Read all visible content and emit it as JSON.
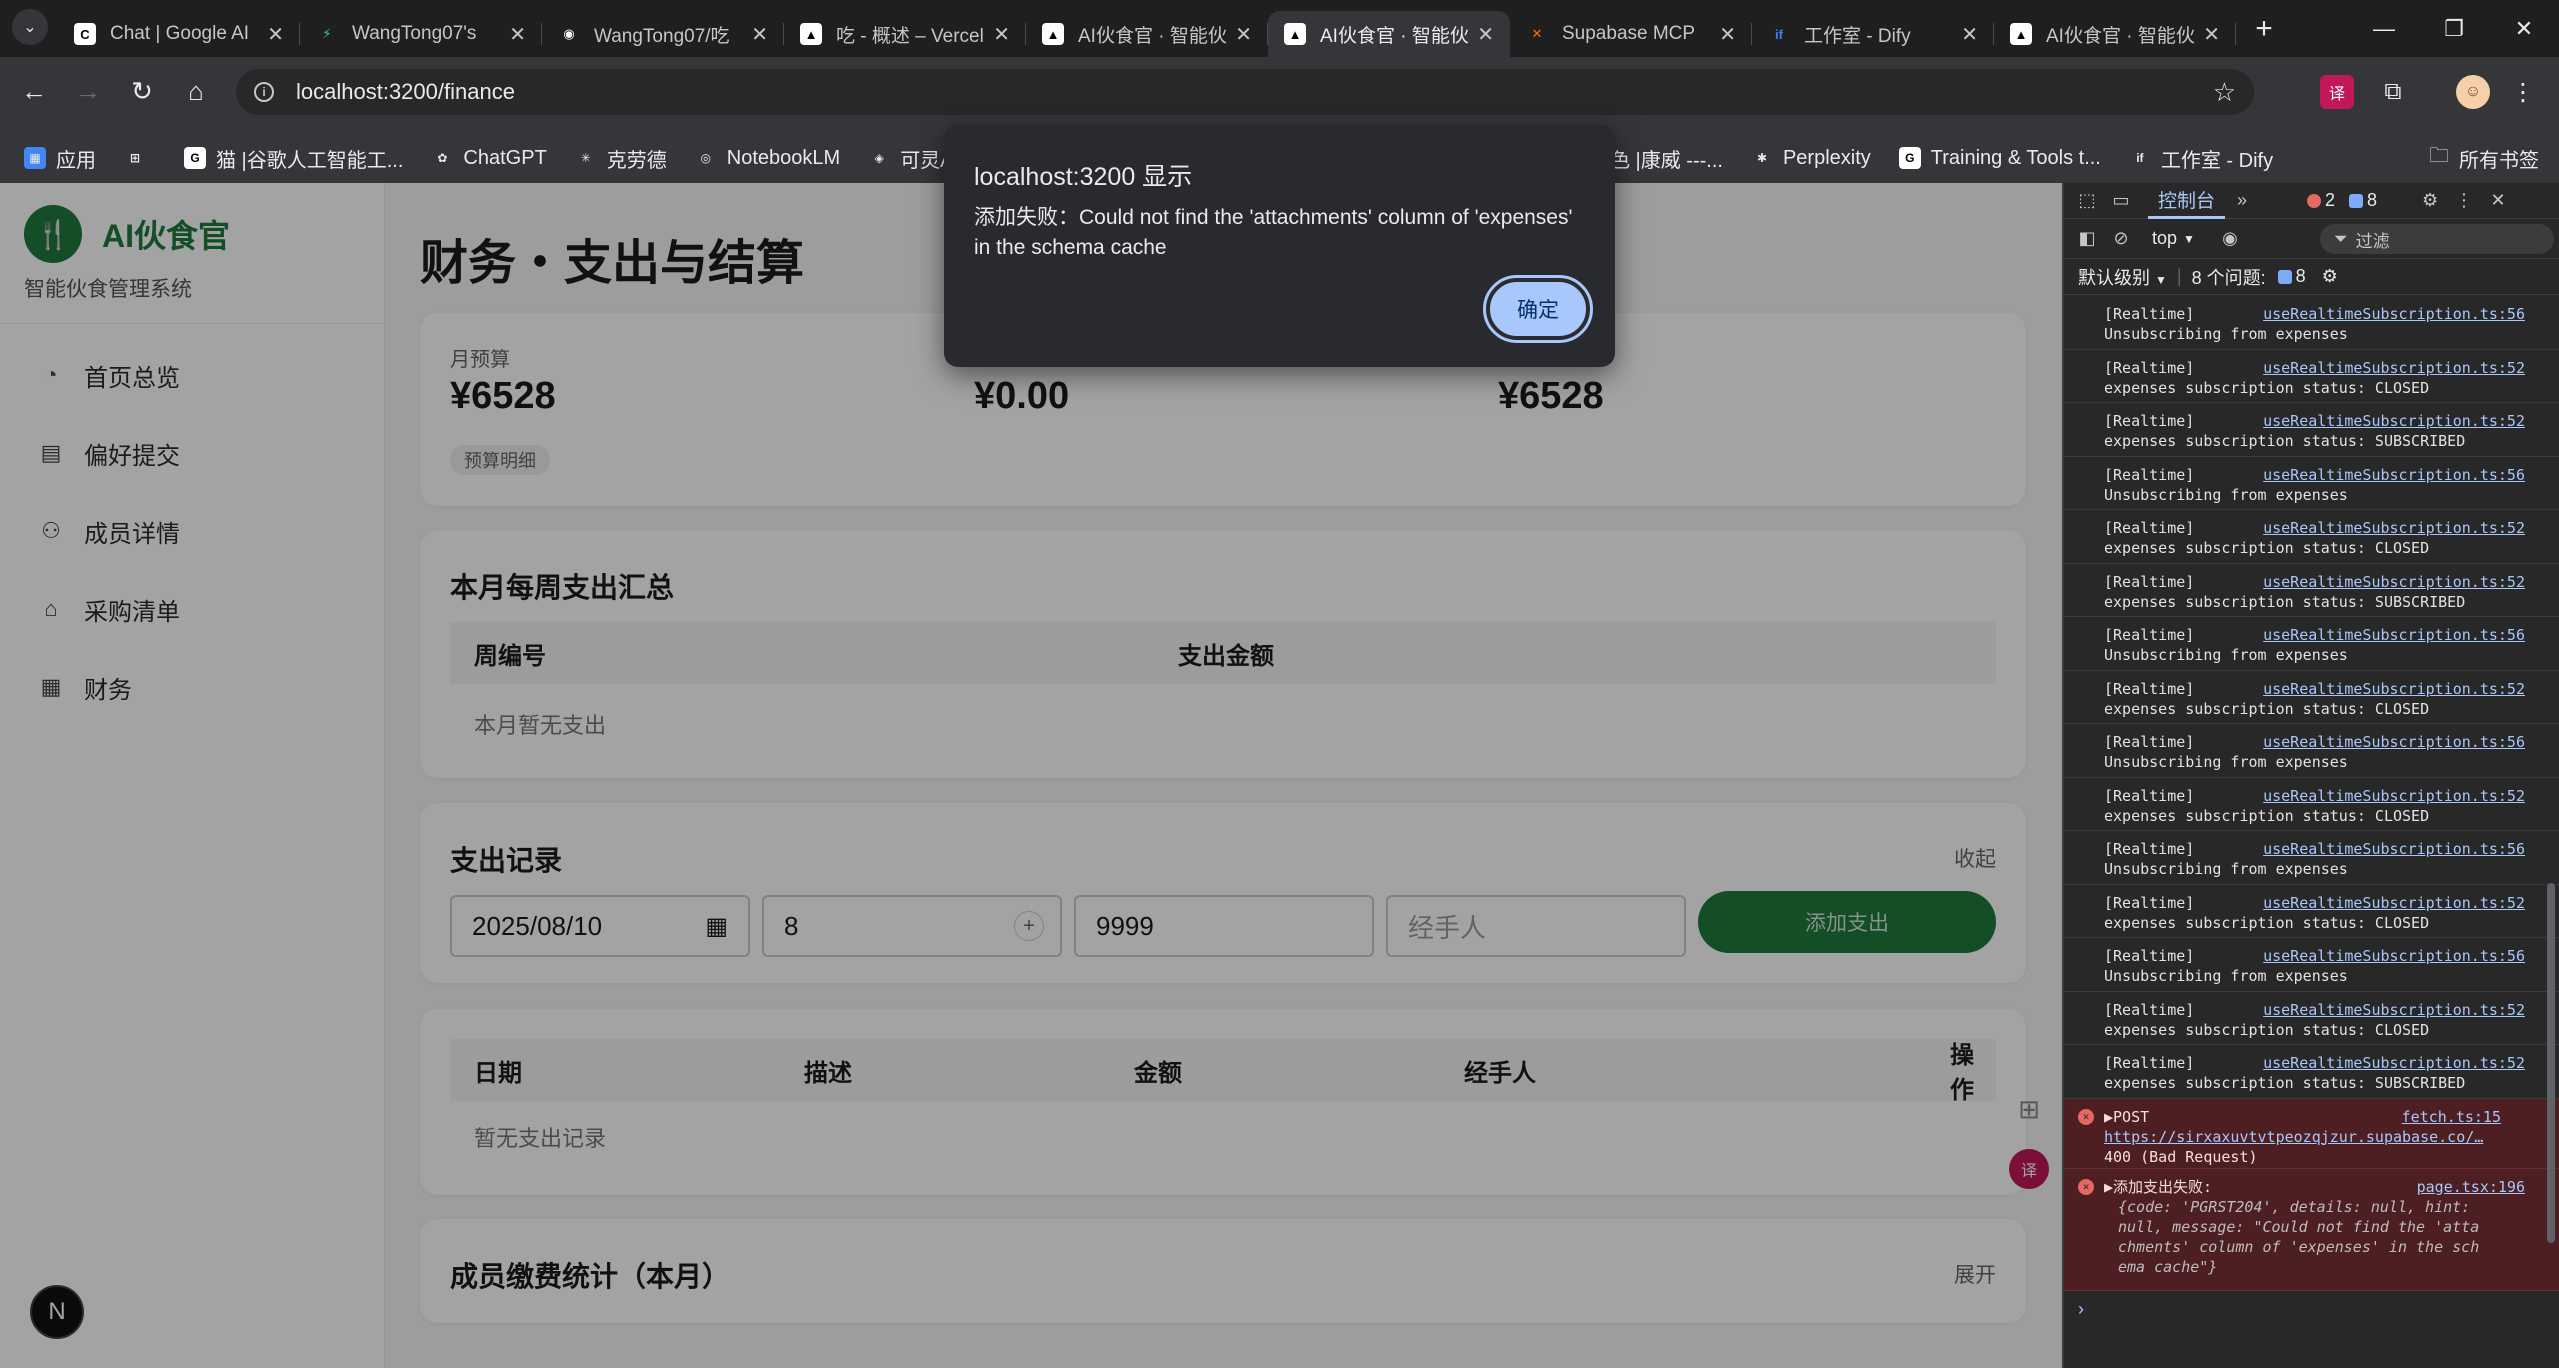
{
  "browser": {
    "tabs": [
      {
        "title": "Chat | Google AI",
        "icon_color": "#ffffff",
        "icon_fg": "#000000",
        "icon": "gemini-icon",
        "glyph": "C"
      },
      {
        "title": "WangTong07's",
        "icon_color": "#1f1f1f",
        "icon_fg": "#34d399",
        "icon": "bolt-icon",
        "glyph": "⚡"
      },
      {
        "title": "WangTong07/吃",
        "icon_color": "#1f1f1f",
        "icon_fg": "#ffffff",
        "icon": "github-icon",
        "glyph": "◉"
      },
      {
        "title": "吃 - 概述 – Vercel",
        "icon_color": "#ffffff",
        "icon_fg": "#000000",
        "icon": "vercel-icon",
        "glyph": "▲"
      },
      {
        "title": "AI伙食官 · 智能伙",
        "icon_color": "#ffffff",
        "icon_fg": "#000000",
        "icon": "vercel-icon",
        "glyph": "▲"
      },
      {
        "title": "AI伙食官 · 智能伙",
        "icon_color": "#ffffff",
        "icon_fg": "#000000",
        "icon": "vercel-icon",
        "glyph": "▲",
        "active": true
      },
      {
        "title": "Supabase MCP",
        "icon_color": "#1f1f1f",
        "icon_fg": "#f97316",
        "icon": "supabase-icon",
        "glyph": "✕"
      },
      {
        "title": "工作室 - Dify",
        "icon_color": "#1f1f1f",
        "icon_fg": "#3b82f6",
        "icon": "dify-icon",
        "glyph": "if"
      },
      {
        "title": "AI伙食官 · 智能伙",
        "icon_color": "#ffffff",
        "icon_fg": "#000000",
        "icon": "vercel-icon",
        "glyph": "▲"
      }
    ],
    "url": "localhost:3200/finance",
    "bookmarks": [
      {
        "label": "应用",
        "icon": "apps-grid-icon",
        "color": "#4285f4",
        "glyph": "▦"
      },
      {
        "label": "",
        "icon": "tab-groups-icon",
        "color": "#35363a",
        "glyph": "⊞"
      },
      {
        "label": "猫 |谷歌人工智能工...",
        "icon": "bookmark-icon",
        "color": "#ffffff",
        "glyph": "G"
      },
      {
        "label": "ChatGPT",
        "icon": "openai-icon",
        "color": "#35363a",
        "glyph": "✿"
      },
      {
        "label": "克劳德",
        "icon": "claude-icon",
        "color": "#35363a",
        "glyph": "✳"
      },
      {
        "label": "NotebookLM",
        "icon": "notebooklm-icon",
        "color": "#35363a",
        "glyph": "◎"
      },
      {
        "label": "可灵AI",
        "icon": "kling-icon",
        "color": "#35363a",
        "glyph": "◈"
      }
    ],
    "bookmarks_right": [
      {
        "label": "色 |康威 ---...",
        "icon": "bookmark-icon",
        "color": "#35363a",
        "glyph": ""
      },
      {
        "label": "Perplexity",
        "icon": "perplexity-icon",
        "color": "#35363a",
        "glyph": "✱"
      },
      {
        "label": "Training & Tools t...",
        "icon": "google-icon",
        "color": "#ffffff",
        "glyph": "G"
      },
      {
        "label": "工作室 - Dify",
        "icon": "dify-icon",
        "color": "#35363a",
        "glyph": "if"
      }
    ],
    "all_bookmarks": "所有书签"
  },
  "app": {
    "brand_name": "AI伙食官",
    "brand_sub": "智能伙食管理系统",
    "nav": [
      {
        "label": "首页总览",
        "icon": "dashboard-icon",
        "glyph": "◔"
      },
      {
        "label": "偏好提交",
        "icon": "form-icon",
        "glyph": "▤"
      },
      {
        "label": "成员详情",
        "icon": "users-gear-icon",
        "glyph": "⚇"
      },
      {
        "label": "采购清单",
        "icon": "basket-icon",
        "glyph": "⌂"
      },
      {
        "label": "财务",
        "icon": "calculator-icon",
        "glyph": "▦"
      }
    ],
    "page_title": "财务・支出与结算",
    "budget": {
      "label1": "月预算",
      "value1": "¥6528",
      "value2": "¥0.00",
      "value3": "¥6528",
      "detail_chip": "预算明细"
    },
    "weekly": {
      "title": "本月每周支出汇总",
      "col1": "周编号",
      "col2": "支出金额",
      "empty": "本月暂无支出"
    },
    "records": {
      "title": "支出记录",
      "collapse": "收起",
      "date_value": "2025/08/10",
      "desc_value": "8",
      "amount_value": "9999",
      "handler_placeholder": "经手人",
      "add_button": "添加支出"
    },
    "records_table": {
      "cols": [
        "日期",
        "描述",
        "金额",
        "经手人",
        "操作"
      ],
      "empty": "暂无支出记录"
    },
    "members_fee": {
      "title": "成员缴费统计（本月）",
      "expand": "展开"
    }
  },
  "dialog": {
    "title": "localhost:3200 显示",
    "message": "添加失败：Could not find the 'attachments' column of 'expenses' in the schema cache",
    "ok": "确定"
  },
  "devtools": {
    "tab_console": "控制台",
    "error_count": "2",
    "message_count": "8",
    "context": "top",
    "filter_placeholder": "过滤",
    "level": "默认级别",
    "issues_label": "8 个问题:",
    "issues_count": "8",
    "logs": [
      {
        "src": "useRealtimeSubscription.ts:56",
        "msg": "Unsubscribing from expenses"
      },
      {
        "src": "useRealtimeSubscription.ts:52",
        "msg": "expenses subscription status: CLOSED"
      },
      {
        "src": "useRealtimeSubscription.ts:52",
        "msg": "expenses subscription status: SUBSCRIBED"
      },
      {
        "src": "useRealtimeSubscription.ts:56",
        "msg": "Unsubscribing from expenses"
      },
      {
        "src": "useRealtimeSubscription.ts:52",
        "msg": "expenses subscription status: CLOSED"
      },
      {
        "src": "useRealtimeSubscription.ts:52",
        "msg": "expenses subscription status: SUBSCRIBED"
      },
      {
        "src": "useRealtimeSubscription.ts:56",
        "msg": "Unsubscribing from expenses"
      },
      {
        "src": "useRealtimeSubscription.ts:52",
        "msg": "expenses subscription status: CLOSED"
      },
      {
        "src": "useRealtimeSubscription.ts:56",
        "msg": "Unsubscribing from expenses"
      },
      {
        "src": "useRealtimeSubscription.ts:52",
        "msg": "expenses subscription status: CLOSED"
      },
      {
        "src": "useRealtimeSubscription.ts:56",
        "msg": "Unsubscribing from expenses"
      },
      {
        "src": "useRealtimeSubscription.ts:52",
        "msg": "expenses subscription status: CLOSED"
      },
      {
        "src": "useRealtimeSubscription.ts:56",
        "msg": "Unsubscribing from expenses"
      },
      {
        "src": "useRealtimeSubscription.ts:52",
        "msg": "expenses subscription status: CLOSED"
      },
      {
        "src": "useRealtimeSubscription.ts:52",
        "msg": "expenses subscription status: SUBSCRIBED"
      }
    ],
    "log_prefix": "[Realtime]",
    "error1": {
      "method": "▶POST",
      "src": "fetch.ts:15",
      "url": "https://sirxaxuvtvtpeozqjzur.supabase.co/…",
      "status": "400 (Bad Request)"
    },
    "error2": {
      "title": "▶添加支出失败:",
      "src": "page.tsx:196",
      "obj_line1": "{code: 'PGRST204', details: null, hint:",
      "obj_line2": "null, message: \"Could not find the 'atta",
      "obj_line3": "chments' column of 'expenses' in the sch",
      "obj_line4": "ema cache\"}"
    }
  }
}
